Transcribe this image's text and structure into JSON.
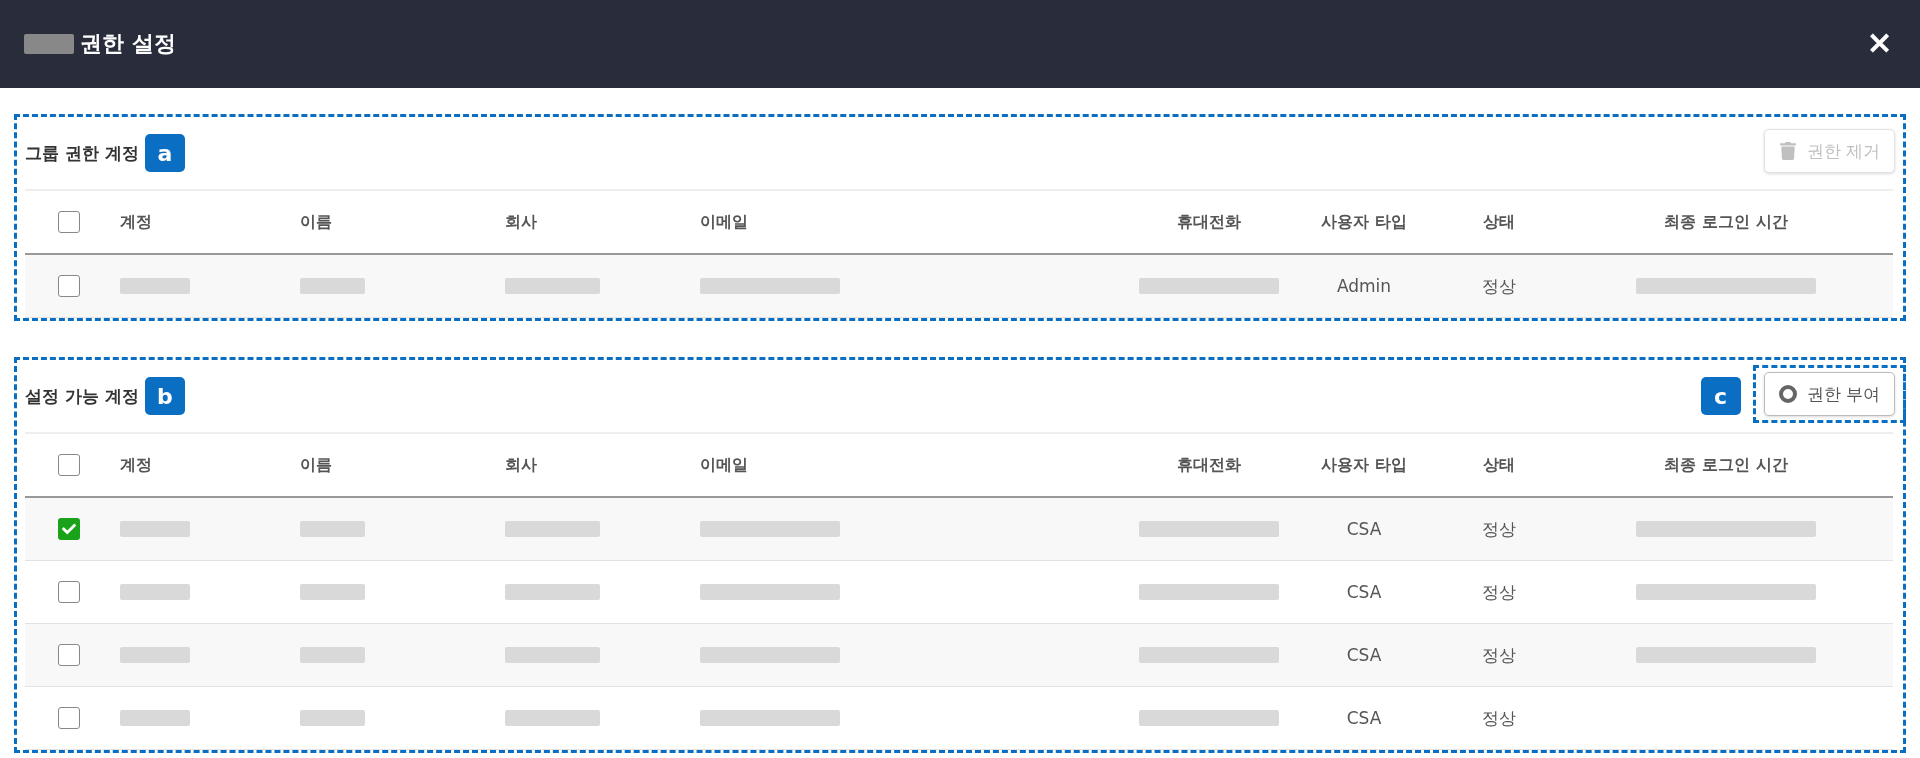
{
  "header": {
    "redacted_prefix": true,
    "title": "권한 설정",
    "close_label": "✕"
  },
  "sections": [
    {
      "title": "그룹 권한 계정",
      "annotation": "a",
      "action": {
        "kind": "remove",
        "label": "권한 제거",
        "disabled": true
      },
      "columns": [
        "계정",
        "이름",
        "회사",
        "이메일",
        "휴대전화",
        "사용자 타입",
        "상태",
        "최종 로그인 시간"
      ],
      "header_checked": false,
      "rows": [
        {
          "checked": false,
          "cells": [
            {
              "kind": "redacted"
            },
            {
              "kind": "redacted"
            },
            {
              "kind": "redacted"
            },
            {
              "kind": "redacted"
            },
            {
              "kind": "redacted"
            },
            {
              "kind": "text",
              "text": "Admin"
            },
            {
              "kind": "text",
              "text": "정상"
            },
            {
              "kind": "redacted"
            }
          ]
        }
      ]
    },
    {
      "title": "설정 가능 계정",
      "annotation": "b",
      "action": {
        "kind": "grant",
        "label": "권한 부여",
        "disabled": false,
        "annotation": "c"
      },
      "columns": [
        "계정",
        "이름",
        "회사",
        "이메일",
        "휴대전화",
        "사용자 타입",
        "상태",
        "최종 로그인 시간"
      ],
      "header_checked": false,
      "rows": [
        {
          "checked": true,
          "cells": [
            {
              "kind": "redacted"
            },
            {
              "kind": "redacted"
            },
            {
              "kind": "redacted"
            },
            {
              "kind": "redacted"
            },
            {
              "kind": "redacted"
            },
            {
              "kind": "text",
              "text": "CSA"
            },
            {
              "kind": "text",
              "text": "정상"
            },
            {
              "kind": "redacted"
            }
          ]
        },
        {
          "checked": false,
          "cells": [
            {
              "kind": "redacted"
            },
            {
              "kind": "redacted"
            },
            {
              "kind": "redacted"
            },
            {
              "kind": "redacted"
            },
            {
              "kind": "redacted"
            },
            {
              "kind": "text",
              "text": "CSA"
            },
            {
              "kind": "text",
              "text": "정상"
            },
            {
              "kind": "redacted"
            }
          ]
        },
        {
          "checked": false,
          "cells": [
            {
              "kind": "redacted"
            },
            {
              "kind": "redacted"
            },
            {
              "kind": "redacted"
            },
            {
              "kind": "redacted"
            },
            {
              "kind": "redacted"
            },
            {
              "kind": "text",
              "text": "CSA"
            },
            {
              "kind": "text",
              "text": "정상"
            },
            {
              "kind": "redacted"
            }
          ]
        },
        {
          "checked": false,
          "cells": [
            {
              "kind": "redacted"
            },
            {
              "kind": "redacted"
            },
            {
              "kind": "redacted"
            },
            {
              "kind": "redacted"
            },
            {
              "kind": "redacted"
            },
            {
              "kind": "text",
              "text": "CSA"
            },
            {
              "kind": "text",
              "text": "정상"
            },
            {
              "kind": "empty"
            }
          ]
        }
      ]
    }
  ]
}
